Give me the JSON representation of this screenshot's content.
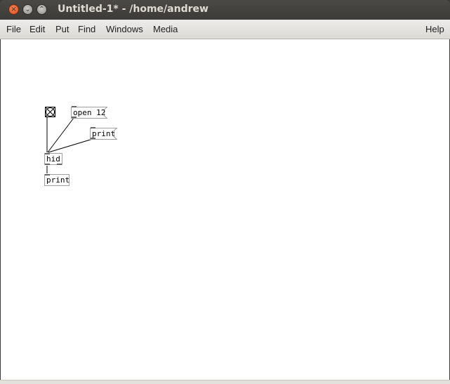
{
  "window": {
    "title": "Untitled-1* - /home/andrew",
    "close_glyph": "×",
    "minimize_glyph": "⌄",
    "maximize_glyph": "⌃"
  },
  "menubar": {
    "items": [
      "File",
      "Edit",
      "Put",
      "Find",
      "Windows",
      "Media"
    ],
    "help": "Help"
  },
  "patch": {
    "message_open": "open 12",
    "message_print": "print",
    "object_hid": "hid",
    "object_print": "print"
  }
}
